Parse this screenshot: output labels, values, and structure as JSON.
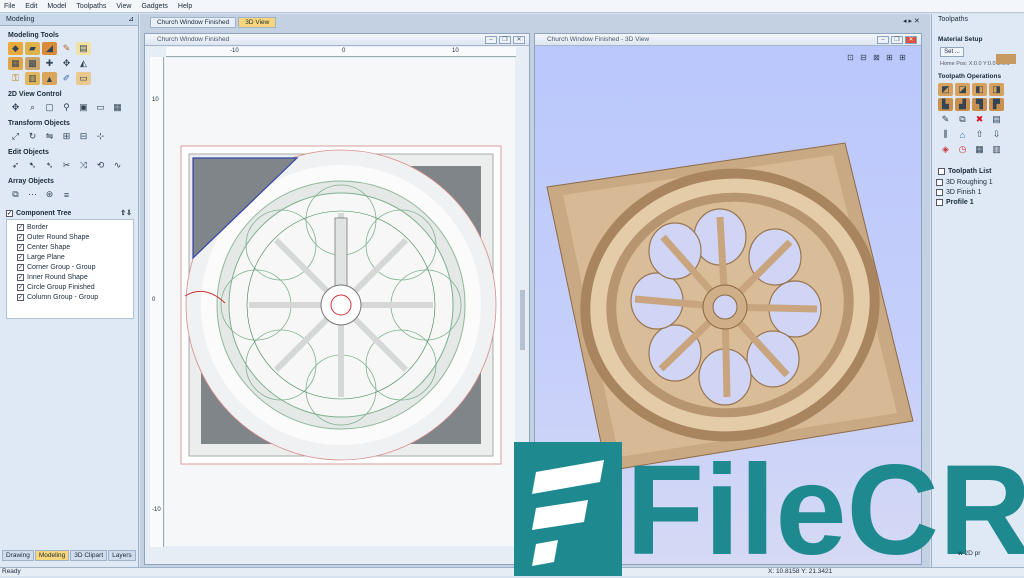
{
  "menu": [
    "File",
    "Edit",
    "Model",
    "Toolpaths",
    "View",
    "Gadgets",
    "Help"
  ],
  "left_panel": {
    "title": "Modeling",
    "sections": [
      "Modeling Tools",
      "2D View Control",
      "Transform Objects",
      "Edit Objects",
      "Array Objects"
    ],
    "tree_title": "Component Tree",
    "tree_items": [
      "Border",
      "Outer Round Shape",
      "Center Shape",
      "Large Plane",
      "Corner Group - Group",
      "Inner Round Shape",
      "Circle Group Finished",
      "Column Group - Group"
    ],
    "bottom_tabs": [
      "Drawing",
      "Modeling",
      "3D Clipart",
      "Layers"
    ]
  },
  "doc_tabs": [
    "Church Window Finished",
    "3D View"
  ],
  "win2d_title": "Church Window Finished",
  "win3d_title": "Church Window Finished - 3D View",
  "ruler": {
    "top": [
      "-10",
      "0",
      "10"
    ],
    "left": [
      "10",
      "0",
      "-10"
    ]
  },
  "right_panel": {
    "title": "Toolpaths",
    "material_setup": "Material Setup",
    "set_button": "Set ...",
    "home_pos": "Home Pos:  X:0.0 Y:0.0 Z:0.1",
    "ops_title": "Toolpath Operations",
    "list_title": "Toolpath List",
    "list_items": [
      "3D Roughing 1",
      "3D Finish 1",
      "Profile 1"
    ],
    "preview_label": "w 2D pr"
  },
  "status": {
    "text": "Ready",
    "coords": "X: 10.8158 Y: 21.3421"
  },
  "watermark": "FileCR",
  "colors": {
    "accent_tab": "#f7d77a",
    "wood": "#d8b996",
    "watermark": "#1e8a8f"
  }
}
